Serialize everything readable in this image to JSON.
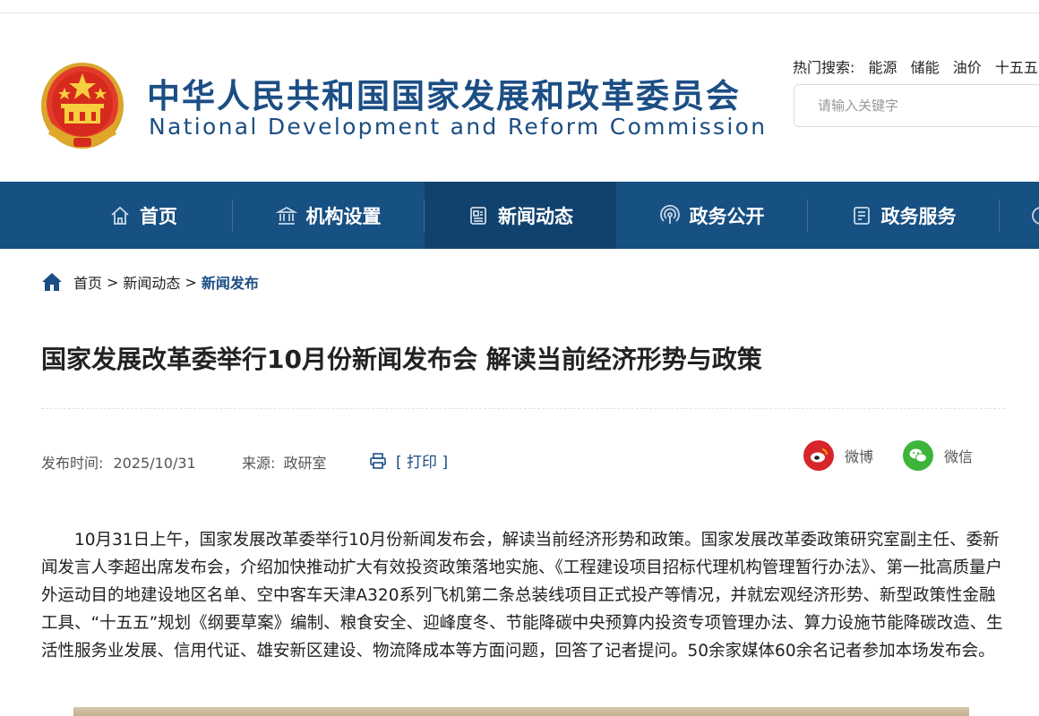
{
  "header": {
    "title_cn": "中华人民共和国国家发展和改革委员会",
    "title_en": "National Development and Reform Commission",
    "hot_label": "热门搜索:",
    "hot_keywords": [
      "能源",
      "储能",
      "油价",
      "十五五"
    ],
    "search_placeholder": "请输入关键字"
  },
  "nav": {
    "items": [
      {
        "label": "首页",
        "icon": "home-icon"
      },
      {
        "label": "机构设置",
        "icon": "institution-icon"
      },
      {
        "label": "新闻动态",
        "icon": "news-icon",
        "active": true
      },
      {
        "label": "政务公开",
        "icon": "broadcast-icon"
      },
      {
        "label": "政务服务",
        "icon": "service-icon"
      }
    ]
  },
  "breadcrumb": {
    "items": [
      "首页",
      "新闻动态",
      "新闻发布"
    ],
    "separator": ">"
  },
  "article": {
    "title": "国家发展改革委举行10月份新闻发布会 解读当前经济形势与政策",
    "publish_label": "发布时间:",
    "publish_date": "2025/10/31",
    "source_label": "来源:",
    "source": "政研室",
    "print_label": "[ 打印 ]",
    "share": {
      "weibo": "微博",
      "wechat": "微信"
    },
    "body": "10月31日上午，国家发展改革委举行10月份新闻发布会，解读当前经济形势和政策。国家发展改革委政策研究室副主任、委新闻发言人李超出席发布会，介绍加快推动扩大有效投资政策落地实施、《工程建设项目招标代理机构管理暂行办法》、第一批高质量户外运动目的地建设地区名单、空中客车天津A320系列飞机第二条总装线项目正式投产等情况，并就宏观经济形势、新型政策性金融工具、“十五五”规划《纲要草案》编制、粮食安全、迎峰度冬、节能降碳中央预算内投资专项管理办法、算力设施节能降碳改造、生活性服务业发展、信用代证、雄安新区建设、物流降成本等方面问题，回答了记者提问。50余家媒体60余名记者参加本场发布会。"
  },
  "colors": {
    "brand": "#1b4e84",
    "nav_bg": "#175082",
    "nav_active": "#11426e",
    "weibo": "#d6252b",
    "wechat": "#3db53b"
  }
}
